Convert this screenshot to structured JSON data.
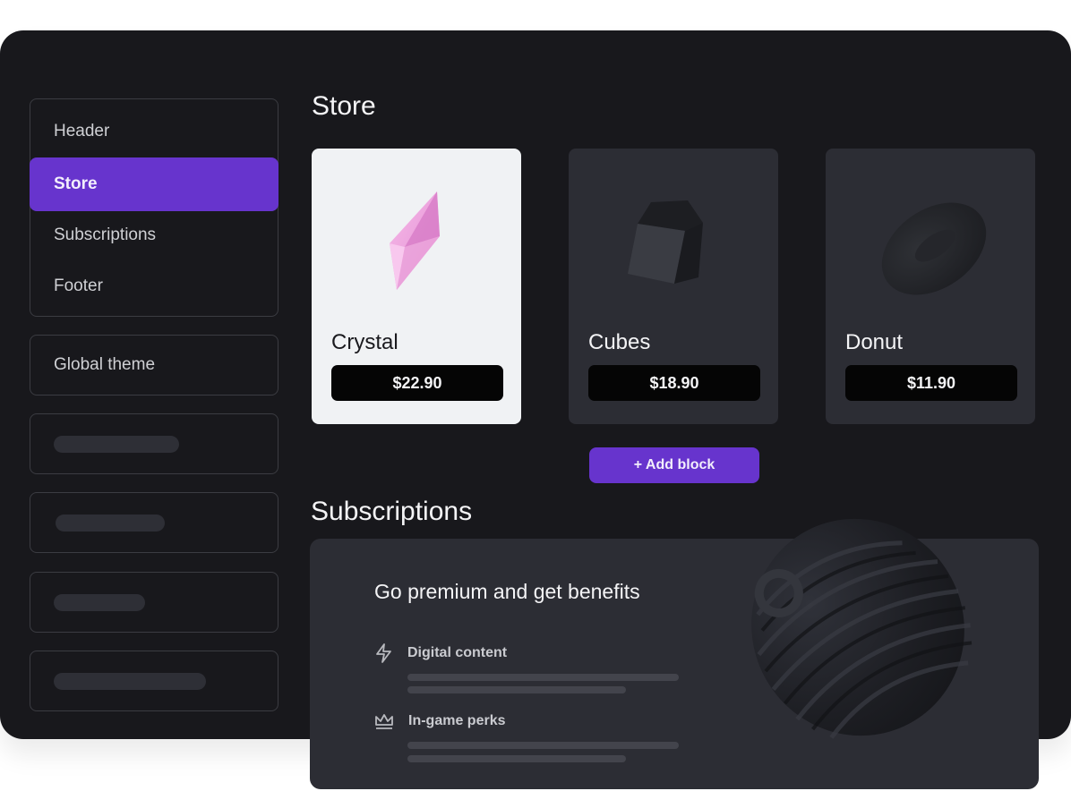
{
  "sidebar": {
    "sections": [
      {
        "label": "Header",
        "active": false
      },
      {
        "label": "Store",
        "active": true
      },
      {
        "label": "Subscriptions",
        "active": false
      },
      {
        "label": "Footer",
        "active": false
      }
    ],
    "global_theme_label": "Global theme",
    "placeholder_items": 4
  },
  "store": {
    "title": "Store",
    "products": [
      {
        "name": "Crystal",
        "price": "$22.90",
        "image": "pink-crystal"
      },
      {
        "name": "Cubes",
        "price": "$18.90",
        "image": "dark-cube"
      },
      {
        "name": "Donut",
        "price": "$11.90",
        "image": "dark-donut"
      }
    ],
    "add_block_label": "+ Add block"
  },
  "subscriptions": {
    "title": "Subscriptions",
    "card_title": "Go premium and get benefits",
    "benefits": [
      {
        "label": "Digital content",
        "icon": "lightning-icon"
      },
      {
        "label": "In-game perks",
        "icon": "crown-icon"
      }
    ],
    "decoration": "dark-spiral-sphere"
  },
  "colors": {
    "accent": "#6734cd",
    "panel_bg": "#18181c",
    "card_bg": "#2c2d34",
    "light_card_bg": "#f0f2f4",
    "price_button_bg": "#050505",
    "border": "#3b3c42"
  }
}
